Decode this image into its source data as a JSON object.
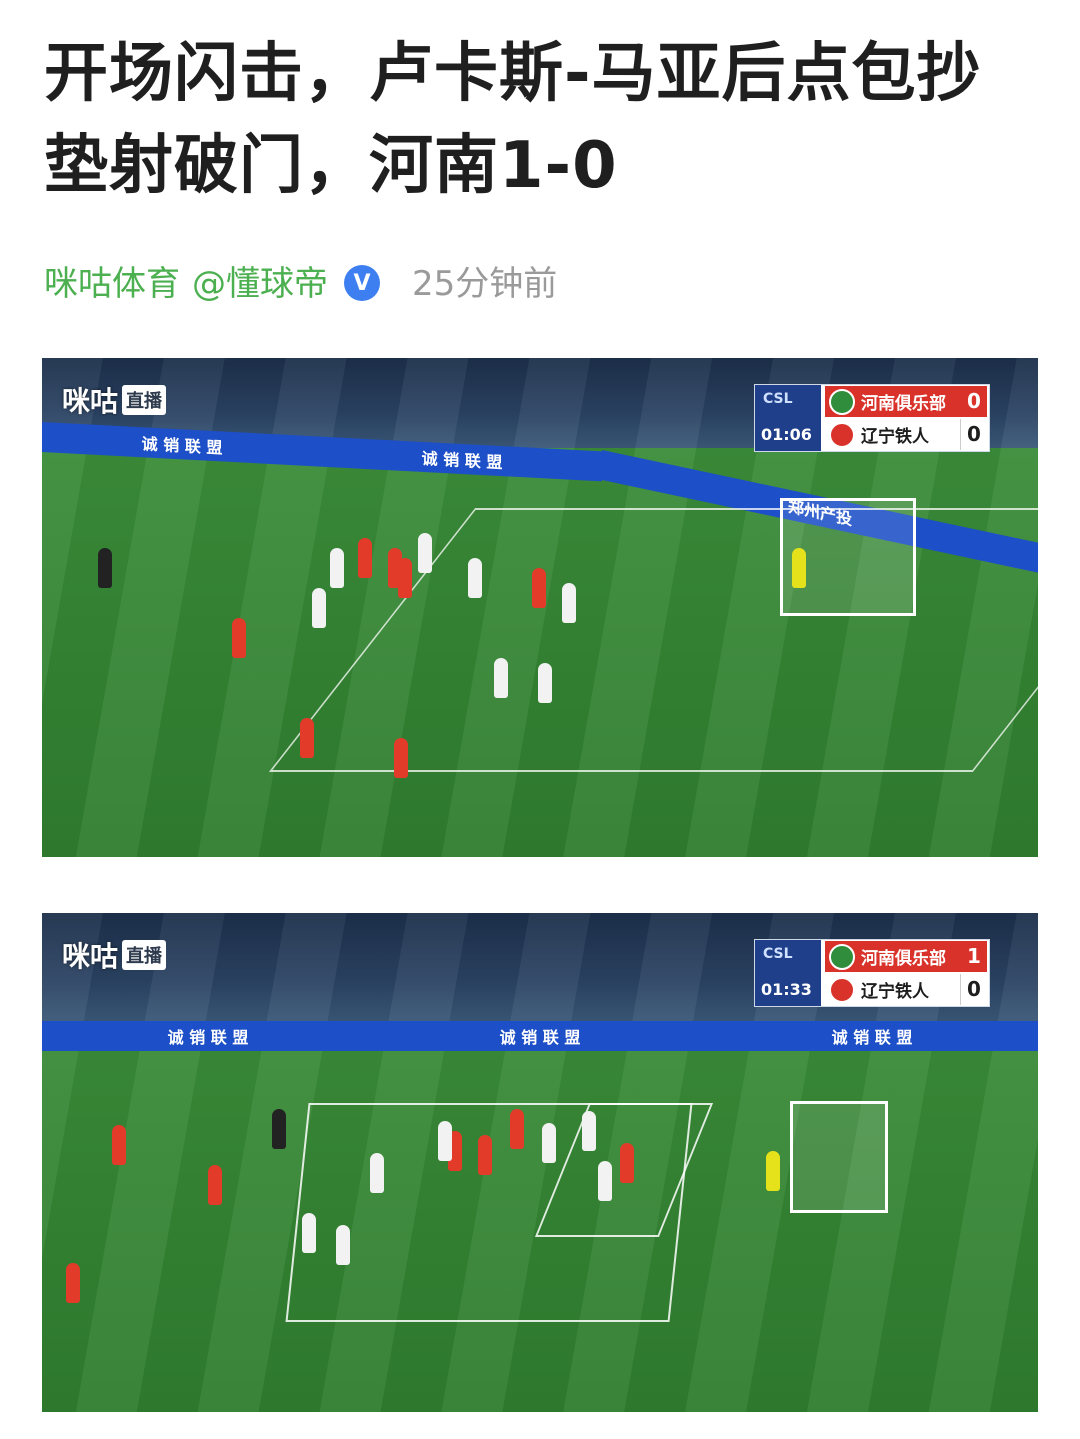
{
  "article": {
    "title": "开场闪击，卢卡斯-马亚后点包抄垫射破门，河南1-0",
    "source": "咪咕体育",
    "author": "@懂球帝",
    "verified_badge": "V",
    "time": "25分钟前"
  },
  "frames": [
    {
      "logo": "咪咕",
      "logo_tag": "直播",
      "league": "CSL",
      "clock": "01:06",
      "home_team": "河南俱乐部",
      "home_score": "0",
      "away_team": "辽宁铁人",
      "away_score": "0",
      "ad_text": "诚 销 联 盟",
      "ad_text_2": "郑州产投"
    },
    {
      "logo": "咪咕",
      "logo_tag": "直播",
      "league": "CSL",
      "clock": "01:33",
      "home_team": "河南俱乐部",
      "home_score": "1",
      "away_team": "辽宁铁人",
      "away_score": "0",
      "ad_text": "诚 销 联 盟",
      "ad_text_2": "诚 销 联 盟"
    }
  ],
  "colors": {
    "source_green": "#4caf50",
    "badge_blue": "#3d7ff0",
    "time_gray": "#9a9a9a",
    "home_red": "#d9322a"
  }
}
